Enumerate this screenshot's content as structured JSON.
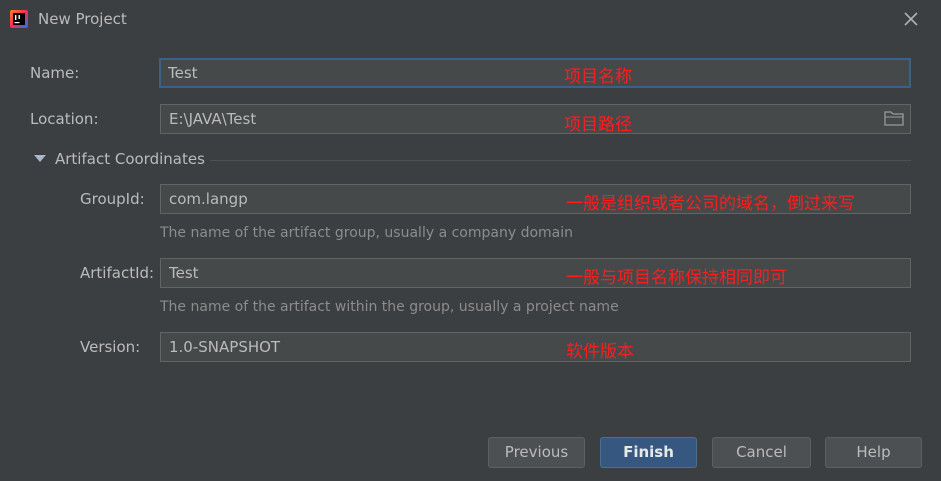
{
  "window": {
    "title": "New Project"
  },
  "form": {
    "name": {
      "label": "Name:",
      "value": "Test",
      "annotation": "项目名称"
    },
    "location": {
      "label": "Location:",
      "value": "E:\\JAVA\\Test",
      "annotation": "项目路径"
    },
    "section": {
      "label": "Artifact Coordinates"
    },
    "group_id": {
      "label": "GroupId:",
      "value": "com.langp",
      "hint": "The name of the artifact group, usually a company domain",
      "annotation": "一般是组织或者公司的域名，倒过来写"
    },
    "artifact_id": {
      "label": "ArtifactId:",
      "value": "Test",
      "hint": "The name of the artifact within the group, usually a project name",
      "annotation": "一般与项目名称保持相同即可"
    },
    "version": {
      "label": "Version:",
      "value": "1.0-SNAPSHOT",
      "annotation": "软件版本"
    }
  },
  "buttons": {
    "previous": "Previous",
    "finish": "Finish",
    "cancel": "Cancel",
    "help": "Help"
  },
  "colors": {
    "background": "#3c3f41",
    "field_bg": "#45494a",
    "focus_border": "#3d6185",
    "primary_button": "#365880",
    "annotation": "#ff1d1d"
  },
  "icons": {
    "app": "intellij-idea-icon",
    "close": "close-icon",
    "folder": "folder-icon",
    "collapse": "triangle-down-icon"
  }
}
